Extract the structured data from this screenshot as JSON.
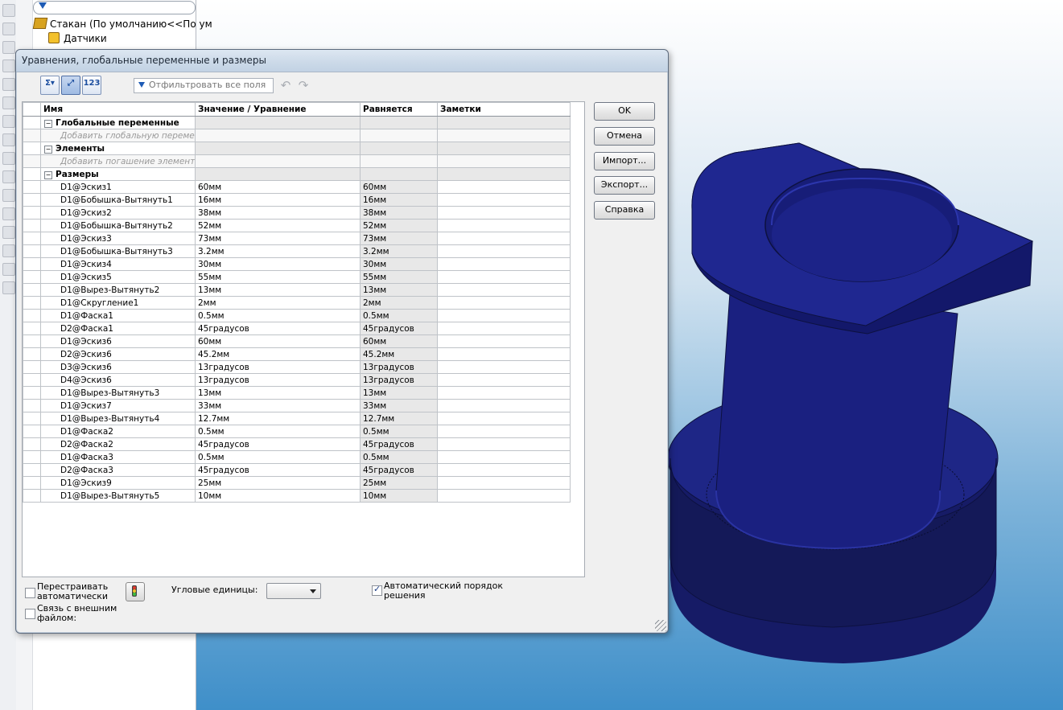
{
  "tree": {
    "root_label": "Стакан  (По умолчанию<<По ум",
    "sensors_label": "Датчики"
  },
  "dialog": {
    "title": "Уравнения, глобальные переменные и размеры",
    "filter_placeholder": "Отфильтровать все поля",
    "columns": [
      "Имя",
      "Значение / Уравнение",
      "Равняется",
      "Заметки"
    ],
    "groups": {
      "globals": {
        "label": "Глобальные переменные",
        "add_hint": "Добавить глобальную перемен"
      },
      "features": {
        "label": "Элементы",
        "add_hint": "Добавить погашение элемента"
      },
      "dims": {
        "label": "Размеры"
      }
    },
    "rows": [
      {
        "name": "D1@Эскиз1",
        "value": "60мм",
        "eq": "60мм"
      },
      {
        "name": "D1@Бобышка-Вытянуть1",
        "value": "16мм",
        "eq": "16мм"
      },
      {
        "name": "D1@Эскиз2",
        "value": "38мм",
        "eq": "38мм"
      },
      {
        "name": "D1@Бобышка-Вытянуть2",
        "value": "52мм",
        "eq": "52мм"
      },
      {
        "name": "D1@Эскиз3",
        "value": "73мм",
        "eq": "73мм"
      },
      {
        "name": "D1@Бобышка-Вытянуть3",
        "value": "3.2мм",
        "eq": "3.2мм"
      },
      {
        "name": "D1@Эскиз4",
        "value": "30мм",
        "eq": "30мм"
      },
      {
        "name": "D1@Эскиз5",
        "value": "55мм",
        "eq": "55мм"
      },
      {
        "name": "D1@Вырез-Вытянуть2",
        "value": "13мм",
        "eq": "13мм"
      },
      {
        "name": "D1@Скругление1",
        "value": "2мм",
        "eq": "2мм"
      },
      {
        "name": "D1@Фаска1",
        "value": "0.5мм",
        "eq": "0.5мм"
      },
      {
        "name": "D2@Фаска1",
        "value": "45градусов",
        "eq": "45градусов"
      },
      {
        "name": "D1@Эскиз6",
        "value": "60мм",
        "eq": "60мм"
      },
      {
        "name": "D2@Эскиз6",
        "value": "45.2мм",
        "eq": "45.2мм"
      },
      {
        "name": "D3@Эскиз6",
        "value": "13градусов",
        "eq": "13градусов"
      },
      {
        "name": "D4@Эскиз6",
        "value": "13градусов",
        "eq": "13градусов"
      },
      {
        "name": "D1@Вырез-Вытянуть3",
        "value": "13мм",
        "eq": "13мм"
      },
      {
        "name": "D1@Эскиз7",
        "value": "33мм",
        "eq": "33мм"
      },
      {
        "name": "D1@Вырез-Вытянуть4",
        "value": "12.7мм",
        "eq": "12.7мм"
      },
      {
        "name": "D1@Фаска2",
        "value": "0.5мм",
        "eq": "0.5мм"
      },
      {
        "name": "D2@Фаска2",
        "value": "45градусов",
        "eq": "45градусов"
      },
      {
        "name": "D1@Фаска3",
        "value": "0.5мм",
        "eq": "0.5мм"
      },
      {
        "name": "D2@Фаска3",
        "value": "45градусов",
        "eq": "45градусов"
      },
      {
        "name": "D1@Эскиз9",
        "value": "25мм",
        "eq": "25мм"
      },
      {
        "name": "D1@Вырез-Вытянуть5",
        "value": "10мм",
        "eq": "10мм"
      }
    ],
    "buttons": {
      "ok": "OK",
      "cancel": "Отмена",
      "import": "Импорт...",
      "export": "Экспорт...",
      "help": "Справка"
    },
    "options": {
      "rebuild_auto": "Перестраивать автоматически",
      "link_external": "Связь с внешним файлом:",
      "angular_units": "Угловые единицы:",
      "angular_units_value": "",
      "auto_order": "Автоматический порядок решения",
      "rebuild_auto_checked": false,
      "link_external_checked": false,
      "auto_order_checked": true
    }
  },
  "colors": {
    "part": "#1a1f78",
    "accent": "#1e5bb5"
  }
}
